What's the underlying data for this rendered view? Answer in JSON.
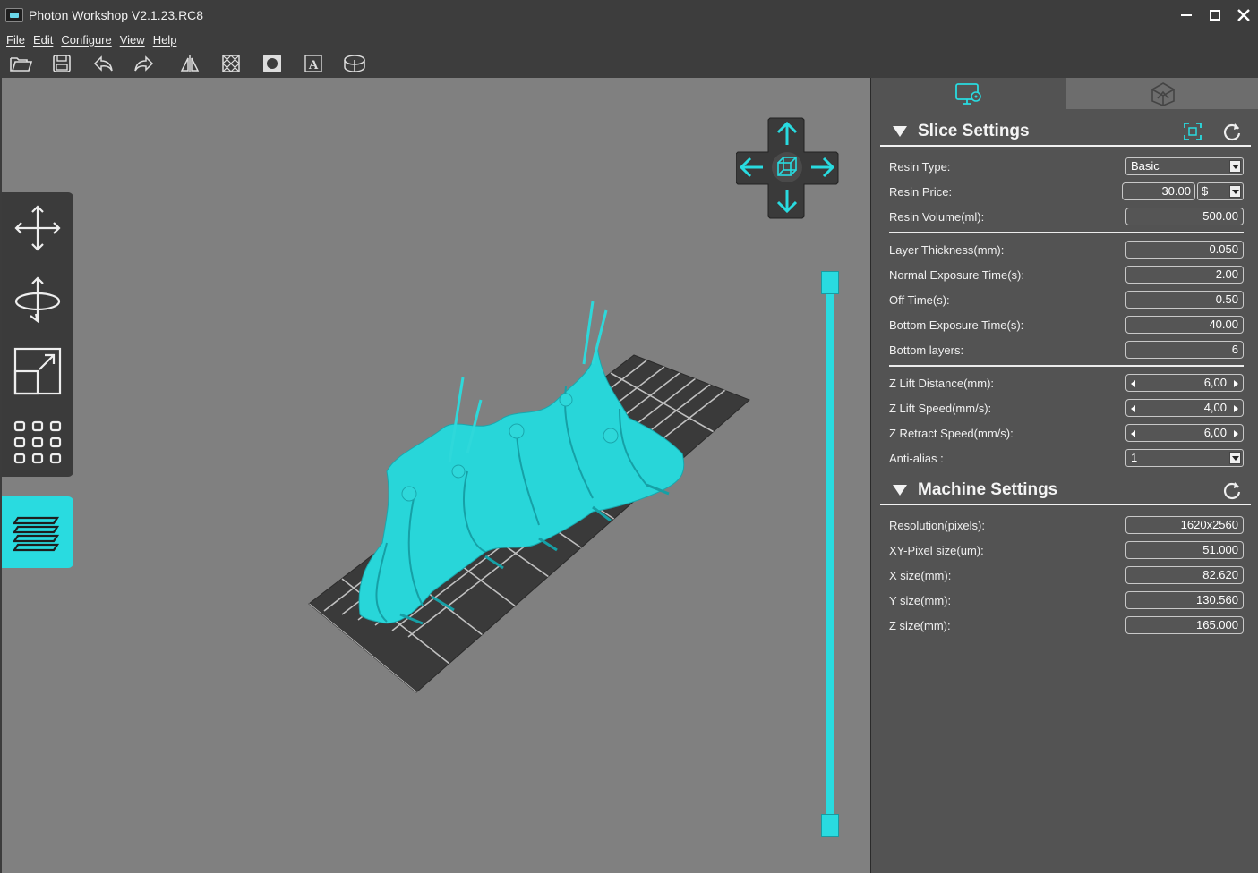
{
  "window": {
    "title": "Photon Workshop V2.1.23.RC8"
  },
  "menu": [
    "File",
    "Edit",
    "Configure",
    "View",
    "Help"
  ],
  "toolbar": {
    "buttons": [
      "open-file",
      "save",
      "undo",
      "redo",
      "mirror",
      "hollow",
      "punch-hole",
      "text",
      "slice"
    ]
  },
  "colors": {
    "accent": "#29dbe0",
    "viewport": "#808080",
    "panel": "#535353"
  },
  "panel": {
    "slice_settings": {
      "title": "Slice Settings",
      "resin_type": {
        "label": "Resin Type:",
        "value": "Basic"
      },
      "resin_price": {
        "label": "Resin Price:",
        "value": "30.00",
        "currency": "$"
      },
      "resin_volume": {
        "label": "Resin Volume(ml):",
        "value": "500.00"
      },
      "layer_thickness": {
        "label": "Layer Thickness(mm):",
        "value": "0.050"
      },
      "normal_exposure": {
        "label": "Normal Exposure Time(s):",
        "value": "2.00"
      },
      "off_time": {
        "label": "Off Time(s):",
        "value": "0.50"
      },
      "bottom_exposure": {
        "label": "Bottom Exposure Time(s):",
        "value": "40.00"
      },
      "bottom_layers": {
        "label": "Bottom layers:",
        "value": "6"
      },
      "z_lift_distance": {
        "label": "Z Lift Distance(mm):",
        "value": "6,00"
      },
      "z_lift_speed": {
        "label": "Z Lift Speed(mm/s):",
        "value": "4,00"
      },
      "z_retract_speed": {
        "label": "Z Retract Speed(mm/s):",
        "value": "6,00"
      },
      "anti_alias": {
        "label": "Anti-alias :",
        "value": "1"
      }
    },
    "machine_settings": {
      "title": "Machine Settings",
      "resolution": {
        "label": "Resolution(pixels):",
        "value": "1620x2560"
      },
      "xy_pixel": {
        "label": "XY-Pixel size(um):",
        "value": "51.000"
      },
      "x_size": {
        "label": "X size(mm):",
        "value": "82.620"
      },
      "y_size": {
        "label": "Y size(mm):",
        "value": "130.560"
      },
      "z_size": {
        "label": "Z size(mm):",
        "value": "165.000"
      }
    }
  }
}
